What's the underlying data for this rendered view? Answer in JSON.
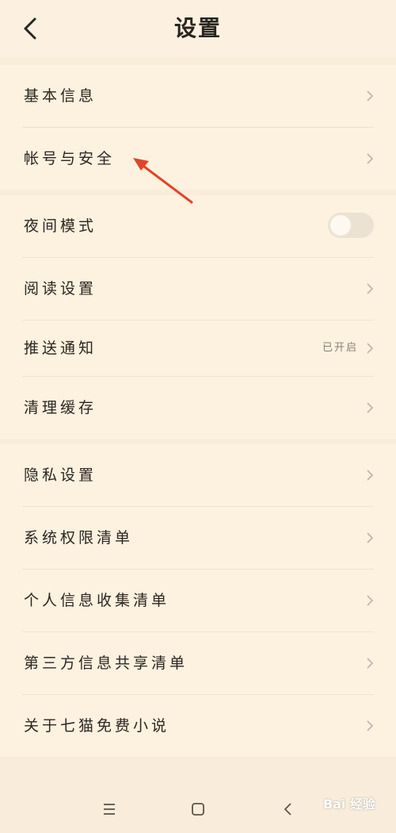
{
  "header": {
    "title": "设置"
  },
  "groups": [
    {
      "items": [
        {
          "label": "基本信息"
        },
        {
          "label": "帐号与安全"
        }
      ]
    },
    {
      "items": [
        {
          "label": "夜间模式",
          "toggle": "off"
        },
        {
          "label": "阅读设置"
        },
        {
          "label": "推送通知",
          "value": "已开启"
        },
        {
          "label": "清理缓存"
        }
      ]
    },
    {
      "items": [
        {
          "label": "隐私设置"
        },
        {
          "label": "系统权限清单"
        },
        {
          "label": "个人信息收集清单"
        },
        {
          "label": "第三方信息共享清单"
        },
        {
          "label": "关于七猫免费小说"
        }
      ]
    }
  ],
  "watermark": "Bai 经验",
  "colors": {
    "background": "#f9ecda",
    "row": "#fdf1e0",
    "arrow": "#e0452a"
  },
  "icons": [
    "back-arrow-icon",
    "chevron-right-icon",
    "menu-icon",
    "home-square-icon",
    "nav-back-icon"
  ]
}
